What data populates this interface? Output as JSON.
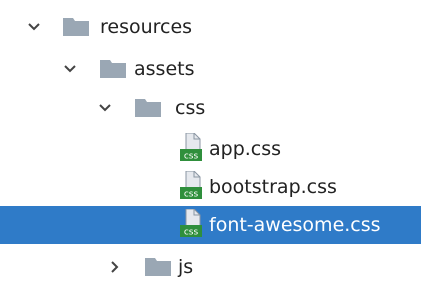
{
  "tree": {
    "folders": [
      {
        "label": "resources",
        "icon": "folder-icon",
        "expanded": true
      },
      {
        "label": "assets",
        "icon": "folder-icon",
        "expanded": true
      },
      {
        "label": "css",
        "icon": "folder-icon",
        "expanded": true
      },
      {
        "label": "js",
        "icon": "folder-icon",
        "expanded": false
      }
    ],
    "files": [
      {
        "label": "app.css",
        "icon": "css-file-icon",
        "badge": "css"
      },
      {
        "label": "bootstrap.css",
        "icon": "css-file-icon",
        "badge": "css"
      },
      {
        "label": "font-awesome.css",
        "icon": "css-file-icon",
        "badge": "css",
        "selected": true
      }
    ]
  },
  "colors": {
    "selection": "#2f7bc8",
    "folder": "#9aa7b4",
    "css_badge": "#2f8f3c",
    "chevron": "#444444"
  }
}
